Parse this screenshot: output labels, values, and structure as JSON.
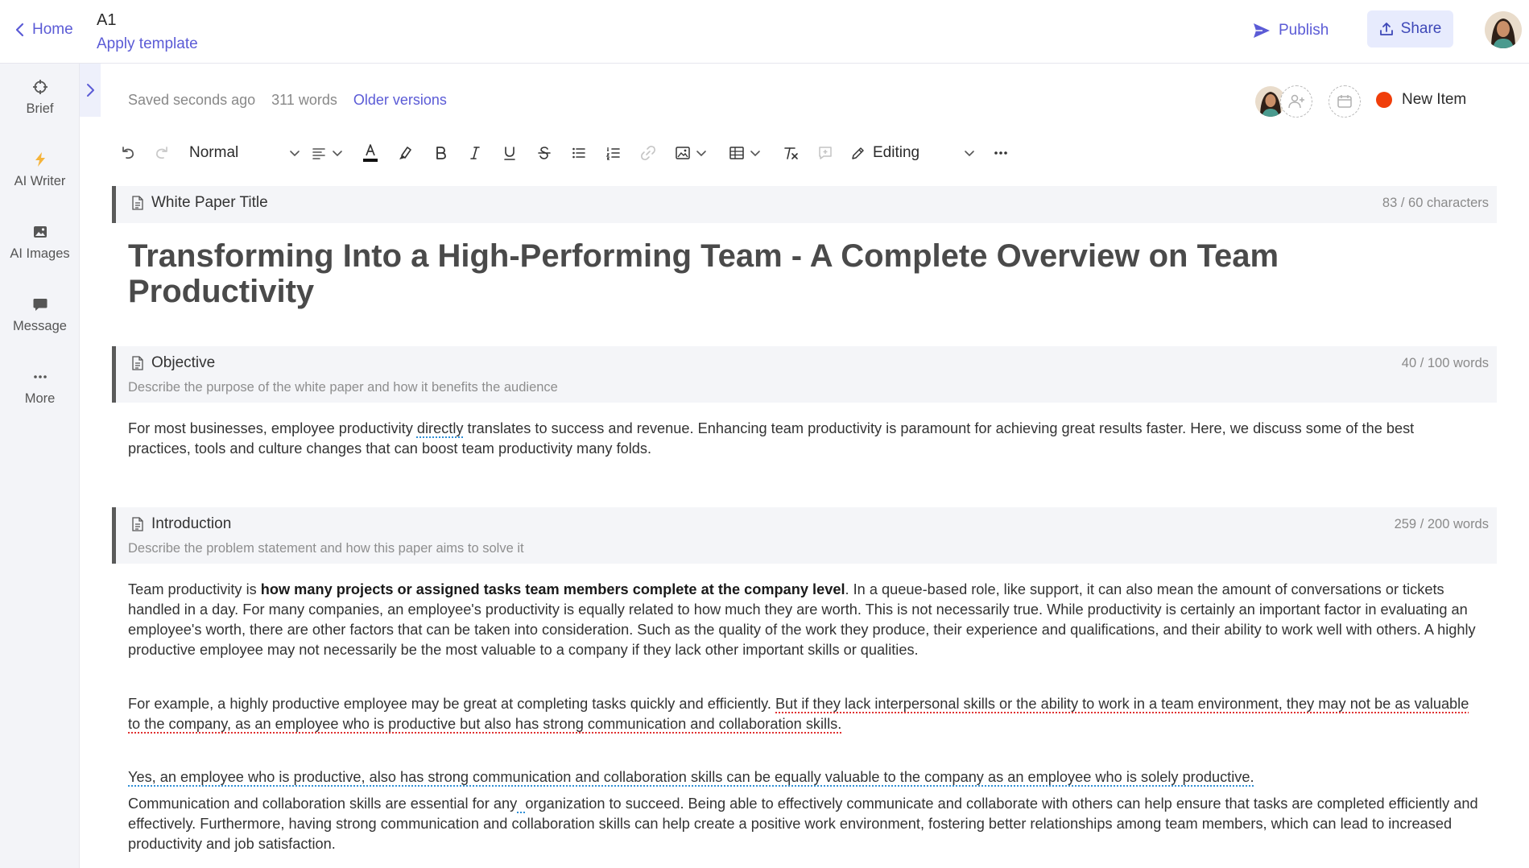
{
  "topbar": {
    "home_label": "Home",
    "doc_title": "A1",
    "apply_template_label": "Apply template",
    "publish_label": "Publish",
    "share_label": "Share"
  },
  "sidebar": {
    "items": [
      {
        "label": "Brief",
        "icon": "crosshair-icon"
      },
      {
        "label": "AI Writer",
        "icon": "lightning-icon"
      },
      {
        "label": "AI Images",
        "icon": "image-icon"
      },
      {
        "label": "Message",
        "icon": "chat-icon"
      },
      {
        "label": "More",
        "icon": "more-dots-icon"
      }
    ]
  },
  "status": {
    "saved": "Saved seconds ago",
    "words": "311 words",
    "older_versions": "Older versions",
    "new_item_label": "New Item",
    "new_item_color": "#f03e0a"
  },
  "toolbar": {
    "style_value": "Normal",
    "mode_value": "Editing"
  },
  "sections": {
    "title": {
      "label": "White Paper Title",
      "count": "83 / 60 characters",
      "heading": "Transforming Into a High-Performing Team - A Complete Overview on Team Productivity"
    },
    "objective": {
      "label": "Objective",
      "count": "40 / 100 words",
      "hint": "Describe the purpose of the white paper and how it benefits the audience",
      "text_a": "For most businesses, employee productivity ",
      "text_flag": "directly",
      "text_b": " translates to success and revenue. Enhancing team productivity is paramount for achieving great results faster. Here, we discuss some of the best practices, tools and culture changes that can boost team productivity many folds."
    },
    "introduction": {
      "label": "Introduction",
      "count": "259 / 200 words",
      "hint": "Describe the problem statement and how this paper aims to solve it",
      "p1_a": "Team productivity is ",
      "p1_bold": "how many projects or assigned tasks team members complete at the company level",
      "p1_b": ". In a queue-based role, like support, it can also mean the amount of conversations or tickets handled in a day. For many companies, an employee's productivity is equally related to how much they are worth.  This is not necessarily true. While productivity is certainly an important factor in evaluating an employee's worth, there are other factors that can be taken into consideration. Such as the quality of the work they produce, their experience and qualifications, and their ability to work well with others. A highly productive employee may not necessarily be the most valuable to a company if they lack other important skills or qualities.",
      "p2_a": " For example, a highly productive employee may be great at completing tasks quickly and efficiently. ",
      "p2_flag": "But if they lack interpersonal skills or the ability to work in a team environment, they may not be as valuable to the company, as an employee who is productive but also has strong communication and collaboration skills.",
      "p3_flag": "Yes, an employee who is productive, also has strong communication and collaboration skills can be equally valuable to the company as an employee who is solely productive.",
      "p4_a": "Communication and collaboration skills are essential for any",
      "p4_flag": "  ",
      "p4_b": "organization to succeed. Being able to effectively communicate and collaborate with others can help ensure that tasks are completed efficiently and effectively. Furthermore, having strong communication and collaboration skills can help create a positive work environment, fostering better relationships among team members, which can lead to increased productivity and job satisfaction."
    }
  }
}
